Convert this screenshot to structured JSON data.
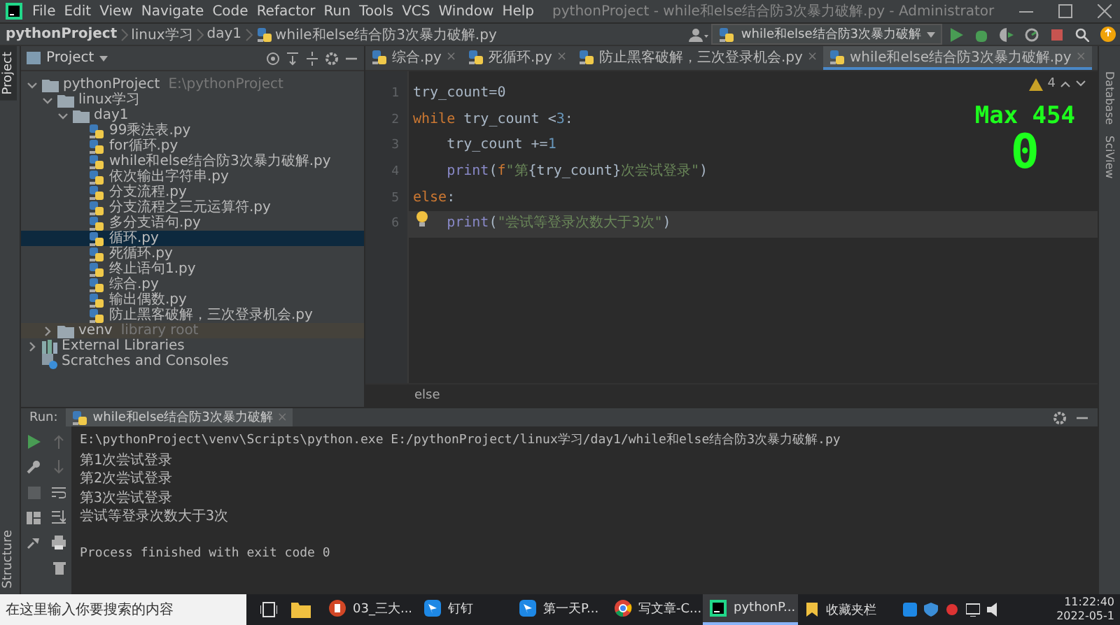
{
  "window": {
    "title": "pythonProject - while和else结合防3次暴力破解.py - Administrator"
  },
  "menu": [
    "File",
    "Edit",
    "View",
    "Navigate",
    "Code",
    "Refactor",
    "Run",
    "Tools",
    "VCS",
    "Window",
    "Help"
  ],
  "breadcrumb": [
    "pythonProject",
    "linux学习",
    "day1",
    "while和else结合防3次暴力破解.py"
  ],
  "run_config": {
    "label": "while和else结合防3次暴力破解"
  },
  "left_strip": {
    "top": [
      {
        "label": "Project",
        "selected": true
      }
    ],
    "bottom": [
      {
        "label": "Structure",
        "selected": false
      }
    ]
  },
  "right_strip": [
    {
      "label": "Database"
    },
    {
      "label": "SciView"
    }
  ],
  "project_panel": {
    "title": "Project",
    "tree": [
      {
        "label": "pythonProject",
        "hint": "E:\\pythonProject",
        "kind": "folder",
        "expanded": true,
        "selected": false,
        "children": [
          {
            "label": "linux学习",
            "kind": "folder",
            "expanded": true,
            "selected": false,
            "children": [
              {
                "label": "day1",
                "kind": "folder",
                "expanded": true,
                "selected": false,
                "children": [
                  {
                    "label": "99乘法表.py",
                    "kind": "python",
                    "selected": false
                  },
                  {
                    "label": "for循环.py",
                    "kind": "python",
                    "selected": false
                  },
                  {
                    "label": "while和else结合防3次暴力破解.py",
                    "kind": "python",
                    "selected": false
                  },
                  {
                    "label": "依次输出字符串.py",
                    "kind": "python",
                    "selected": false
                  },
                  {
                    "label": "分支流程.py",
                    "kind": "python",
                    "selected": false
                  },
                  {
                    "label": "分支流程之三元运算符.py",
                    "kind": "python",
                    "selected": false
                  },
                  {
                    "label": "多分支语句.py",
                    "kind": "python",
                    "selected": false
                  },
                  {
                    "label": "循环.py",
                    "kind": "python",
                    "selected": true
                  },
                  {
                    "label": "死循环.py",
                    "kind": "python",
                    "selected": false
                  },
                  {
                    "label": "终止语句1.py",
                    "kind": "python",
                    "selected": false
                  },
                  {
                    "label": "综合.py",
                    "kind": "python",
                    "selected": false
                  },
                  {
                    "label": "输出偶数.py",
                    "kind": "python",
                    "selected": false
                  },
                  {
                    "label": "防止黑客破解，三次登录机会.py",
                    "kind": "python",
                    "selected": false
                  }
                ]
              }
            ]
          },
          {
            "label": "venv",
            "hint": "library root",
            "kind": "venv",
            "expanded": false,
            "selected": false
          }
        ]
      },
      {
        "label": "External Libraries",
        "kind": "library",
        "expanded": false,
        "selected": false
      },
      {
        "label": "Scratches and Consoles",
        "kind": "scratch",
        "selected": false
      }
    ]
  },
  "editor": {
    "tabs": [
      {
        "label": "综合.py",
        "close": "×",
        "selected": false
      },
      {
        "label": "死循环.py",
        "close": "×",
        "selected": false
      },
      {
        "label": "防止黑客破解，三次登录机会.py",
        "close": "×",
        "selected": false
      },
      {
        "label": "while和else结合防3次暴力破解.py",
        "close": "×",
        "selected": true
      }
    ],
    "warnings": "4",
    "lines": [
      {
        "number": "1",
        "current": false,
        "indented": false,
        "tokens": [
          {
            "kind": "plain",
            "text": "try_count=0"
          }
        ]
      },
      {
        "number": "2",
        "current": false,
        "indented": false,
        "tokens": [
          {
            "kind": "kw",
            "text": "while"
          },
          {
            "kind": "plain",
            "text": " try_count <"
          },
          {
            "kind": "num",
            "text": "3"
          },
          {
            "kind": "plain",
            "text": ":"
          }
        ]
      },
      {
        "number": "3",
        "current": false,
        "indented": true,
        "tokens": [
          {
            "kind": "plain",
            "text": "try_count +="
          },
          {
            "kind": "num",
            "text": "1"
          }
        ]
      },
      {
        "number": "4",
        "current": false,
        "indented": true,
        "tokens": [
          {
            "kind": "fn",
            "text": "print"
          },
          {
            "kind": "plain",
            "text": "("
          },
          {
            "kind": "kw",
            "text": "f"
          },
          {
            "kind": "str",
            "text": "\"第"
          },
          {
            "kind": "plain",
            "text": "{try_count}"
          },
          {
            "kind": "str",
            "text": "次尝试登录\""
          },
          {
            "kind": "plain",
            "text": ")"
          }
        ]
      },
      {
        "number": "5",
        "current": false,
        "indented": false,
        "tokens": [
          {
            "kind": "kw",
            "text": "else"
          },
          {
            "kind": "plain",
            "text": ":"
          }
        ]
      },
      {
        "number": "6",
        "current": true,
        "indented": true,
        "tokens": [
          {
            "kind": "fn",
            "text": "print"
          },
          {
            "kind": "plain",
            "text": "("
          },
          {
            "kind": "str",
            "text": "\"尝试等登录次数大于3次\""
          },
          {
            "kind": "plain",
            "text": ")"
          }
        ]
      }
    ],
    "breadcrumb": "else"
  },
  "overlay": {
    "max": "Max 454",
    "count": "0"
  },
  "run_panel": {
    "label": "Run:",
    "tab": "while和else结合防3次暴力破解",
    "close": "×",
    "output": [
      {
        "kind": "command",
        "text": "E:\\pythonProject\\venv\\Scripts\\python.exe E:/pythonProject/linux学习/day1/while和else结合防3次暴力破解.py"
      },
      {
        "kind": "stdout",
        "text": "第1次尝试登录"
      },
      {
        "kind": "stdout",
        "text": "第2次尝试登录"
      },
      {
        "kind": "stdout",
        "text": "第3次尝试登录"
      },
      {
        "kind": "stdout",
        "text": "尝试等登录次数大于3次"
      },
      {
        "kind": "exit",
        "text": "Process finished with exit code 0"
      }
    ]
  },
  "taskbar": {
    "search": {
      "placeholder": "在这里输入你要搜索的内容"
    },
    "apps": [
      {
        "label": "03_三大...",
        "kind": "slides",
        "selected": false
      },
      {
        "label": "钉钉",
        "kind": "chat",
        "selected": false
      },
      {
        "label": "第一天P...",
        "kind": "chat",
        "selected": false
      },
      {
        "label": "写文章-C...",
        "kind": "browser",
        "selected": false
      },
      {
        "label": "pythonP...",
        "kind": "ide",
        "selected": true
      }
    ],
    "favorites": "收藏夹栏",
    "time": "11:22:40",
    "date": "2022-05-1"
  }
}
